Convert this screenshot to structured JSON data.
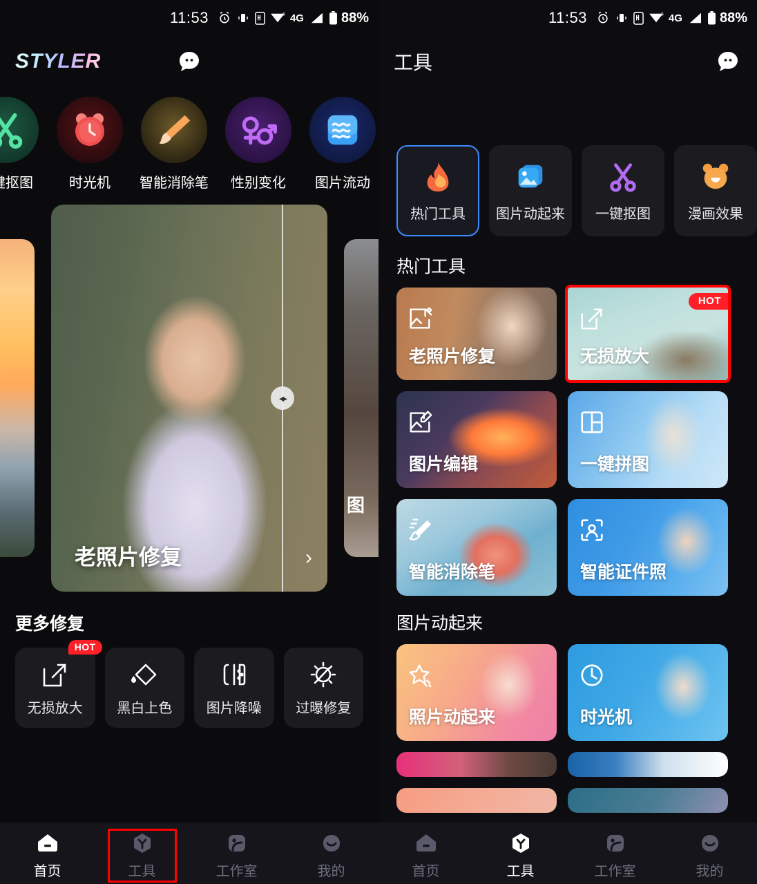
{
  "status_bar": {
    "time": "11:53",
    "battery": "88%",
    "network": "4G",
    "icons": [
      "alarm-icon",
      "vibrate-icon",
      "hd-icon",
      "wifi-icon",
      "signal-icon",
      "battery-icon"
    ]
  },
  "left_screen": {
    "header": {
      "logo": "STYLER",
      "chat_icon": "chat-bubble-icon"
    },
    "quick_tools": [
      {
        "label": "一键抠图",
        "icon": "scissors-icon",
        "color": "#16percent"
      },
      {
        "label": "时光机",
        "icon": "alarm-clock-icon"
      },
      {
        "label": "智能消除笔",
        "icon": "paint-brush-icon"
      },
      {
        "label": "性别变化",
        "icon": "gender-swap-icon"
      },
      {
        "label": "图片流动",
        "icon": "waves-icon"
      }
    ],
    "carousel": {
      "title": "老照片修复",
      "arrow": "›",
      "compare_handle": "◂▸"
    },
    "more_section": {
      "title": "更多修复",
      "tiles": [
        {
          "label": "无损放大",
          "icon": "expand-arrow-icon",
          "badge": "HOT"
        },
        {
          "label": "黑白上色",
          "icon": "paint-bucket-icon",
          "badge": ""
        },
        {
          "label": "图片降噪",
          "icon": "denoise-icon",
          "badge": ""
        },
        {
          "label": "过曝修复",
          "icon": "exposure-icon",
          "badge": ""
        }
      ]
    },
    "bottom_nav": [
      {
        "label": "首页",
        "icon": "home-icon",
        "active": true
      },
      {
        "label": "工具",
        "icon": "tools-hex-icon",
        "active": false,
        "highlighted": true
      },
      {
        "label": "工作室",
        "icon": "studio-icon",
        "active": false
      },
      {
        "label": "我的",
        "icon": "profile-icon",
        "active": false
      }
    ]
  },
  "right_screen": {
    "header": {
      "title": "工具",
      "chat_icon": "chat-bubble-icon"
    },
    "categories": [
      {
        "label": "热门工具",
        "icon": "fire-icon",
        "active": true
      },
      {
        "label": "图片动起来",
        "icon": "photo-icon",
        "active": false
      },
      {
        "label": "一键抠图",
        "icon": "scissors-icon",
        "active": false
      },
      {
        "label": "漫画效果",
        "icon": "bear-face-icon",
        "active": false
      }
    ],
    "sections": [
      {
        "title": "热门工具",
        "cards": [
          {
            "label": "老照片修复",
            "icon": "photo-repair-icon",
            "badge": "",
            "highlighted": false
          },
          {
            "label": "无损放大",
            "icon": "expand-arrow-icon",
            "badge": "HOT",
            "highlighted": true
          },
          {
            "label": "图片编辑",
            "icon": "photo-edit-icon",
            "badge": "",
            "highlighted": false
          },
          {
            "label": "一键拼图",
            "icon": "collage-icon",
            "badge": "",
            "highlighted": false
          },
          {
            "label": "智能消除笔",
            "icon": "eraser-pen-icon",
            "badge": "",
            "highlighted": false
          },
          {
            "label": "智能证件照",
            "icon": "id-photo-icon",
            "badge": "",
            "highlighted": false
          }
        ]
      },
      {
        "title": "图片动起来",
        "cards": [
          {
            "label": "照片动起来",
            "icon": "star-sparkle-icon",
            "badge": "",
            "highlighted": false
          },
          {
            "label": "时光机",
            "icon": "clock-icon",
            "badge": "",
            "highlighted": false
          }
        ]
      }
    ],
    "bottom_nav": [
      {
        "label": "首页",
        "icon": "home-icon",
        "active": false
      },
      {
        "label": "工具",
        "icon": "tools-hex-icon",
        "active": true
      },
      {
        "label": "工作室",
        "icon": "studio-icon",
        "active": false
      },
      {
        "label": "我的",
        "icon": "profile-icon",
        "active": false
      }
    ]
  },
  "colors": {
    "accent_blue": "#3d8bfd",
    "hot_red": "#ff1f28",
    "highlight_red": "#ff0000",
    "bg": "#0d0d11",
    "nav_bg": "#15151b"
  }
}
